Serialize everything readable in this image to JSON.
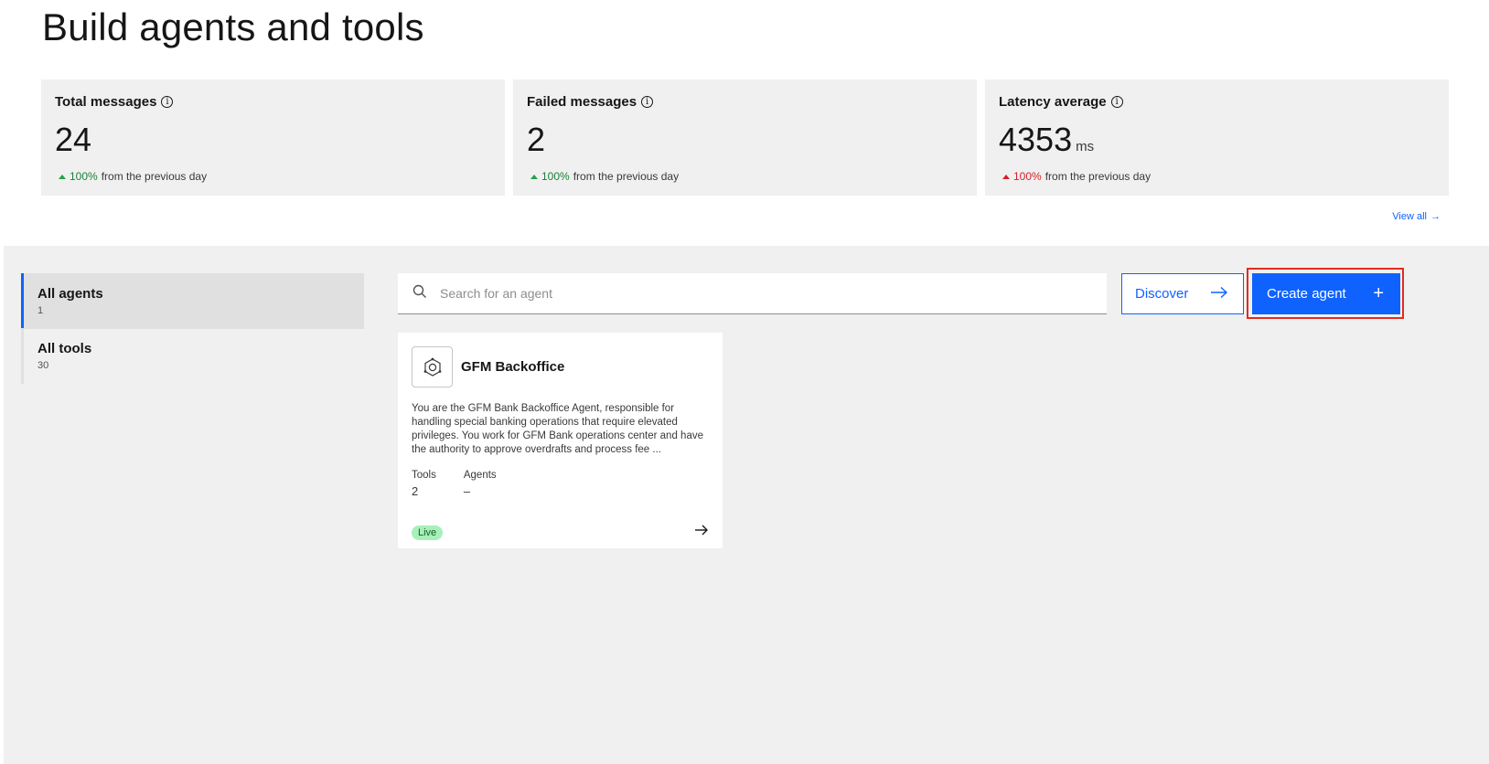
{
  "page": {
    "title": "Build agents and tools"
  },
  "kpis": [
    {
      "title": "Total messages",
      "value": "24",
      "unit": "",
      "delta_pct": "100%",
      "delta_text": "from the previous day",
      "trend": "up",
      "trend_color": "#24a148"
    },
    {
      "title": "Failed messages",
      "value": "2",
      "unit": "",
      "delta_pct": "100%",
      "delta_text": "from the previous day",
      "trend": "up",
      "trend_color": "#24a148"
    },
    {
      "title": "Latency average",
      "value": "4353",
      "unit": "ms",
      "delta_pct": "100%",
      "delta_text": "from the previous day",
      "trend": "up",
      "trend_color": "#da1e28"
    }
  ],
  "view_all": {
    "label": "View all",
    "icon": "arrow-right-icon"
  },
  "sidebar": {
    "items": [
      {
        "label": "All agents",
        "count": "1",
        "active": true
      },
      {
        "label": "All tools",
        "count": "30",
        "active": false
      }
    ]
  },
  "search": {
    "placeholder": "Search for an agent",
    "value": "",
    "icon": "search-icon"
  },
  "actions": {
    "discover_label": "Discover",
    "create_label": "Create agent"
  },
  "agents": [
    {
      "name": "GFM Backoffice",
      "icon": "agent-hexagon-icon",
      "description": "You are the GFM Bank Backoffice Agent, responsible for handling special banking operations that require elevated privileges. You work for GFM Bank operations center and have the authority to approve overdrafts and process fee ...",
      "tools_label": "Tools",
      "tools_value": "2",
      "agents_label": "Agents",
      "agents_value": "–",
      "status": "Live"
    }
  ],
  "colors": {
    "primary": "#0f62fe",
    "highlight": "#e32b1d",
    "live_badge": "#a7f0ba"
  }
}
